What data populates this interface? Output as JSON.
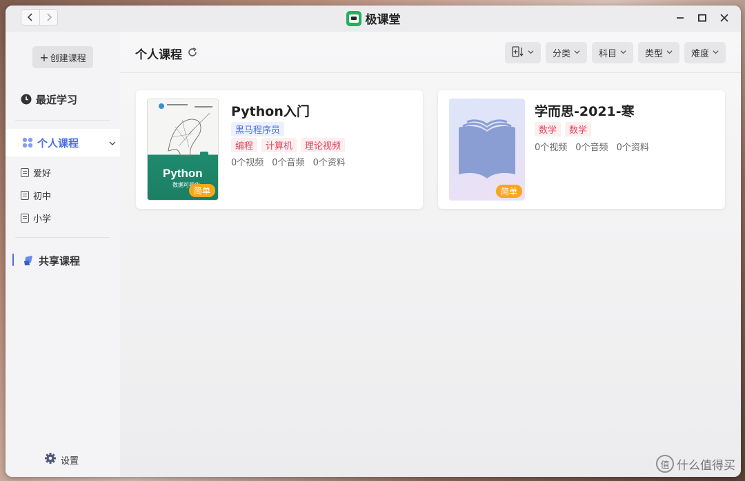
{
  "window": {
    "title": "极课堂"
  },
  "sidebar": {
    "create_label": "创建课程",
    "recent_label": "最近学习",
    "personal_label": "个人课程",
    "sub_items": [
      {
        "label": "爱好"
      },
      {
        "label": "初中"
      },
      {
        "label": "小学"
      }
    ],
    "shared_label": "共享课程",
    "settings_label": "设置"
  },
  "main": {
    "page_title": "个人课程",
    "filters": [
      "分类",
      "科目",
      "类型",
      "难度"
    ],
    "cards": [
      {
        "title": "Python入门",
        "cover_text": "Python",
        "cover_subtext": "数据可视化",
        "badge": "简单",
        "tag_blue": "黑马程序员",
        "tags": [
          "编程",
          "计算机",
          "理论视频"
        ],
        "stats": [
          "0个视频",
          "0个音频",
          "0个资料"
        ]
      },
      {
        "title": "学而思-2021-寒",
        "badge": "简单",
        "tags": [
          "数学",
          "数学"
        ],
        "stats": [
          "0个视频",
          "0个音频",
          "0个资料"
        ]
      }
    ]
  },
  "watermark": {
    "text": "什么值得买",
    "mark": "值"
  },
  "colors": {
    "accent": "#4a6ee0",
    "badge": "#f5a91a",
    "tag_red": "#e0465e",
    "logo_green": "#1fb35b"
  }
}
